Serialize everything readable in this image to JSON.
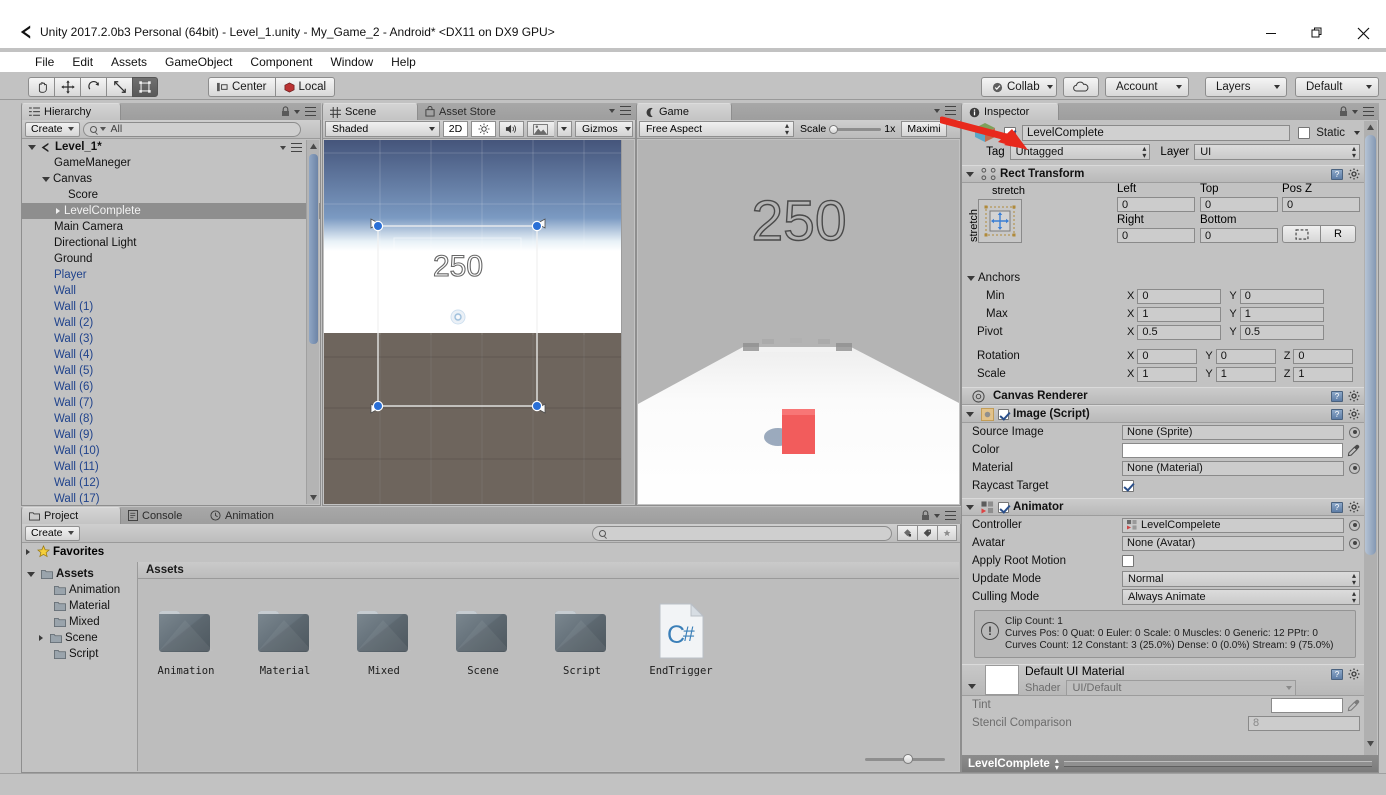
{
  "window": {
    "title": "Unity 2017.2.0b3 Personal (64bit) - Level_1.unity - My_Game_2 - Android* <DX11 on DX9 GPU>",
    "minimize": "–",
    "maximize": "❐",
    "close": "✕"
  },
  "menu": [
    "File",
    "Edit",
    "Assets",
    "GameObject",
    "Component",
    "Window",
    "Help"
  ],
  "toolbar": {
    "transform_tools": [
      "hand-tool",
      "move-tool",
      "rotate-tool",
      "scale-tool",
      "rect-tool"
    ],
    "pivot_mode": "Center",
    "pivot_rotation": "Local",
    "play": "▶",
    "pause": "❚❚",
    "step": "▶❘",
    "collab": "Collab",
    "cloud": "cloud-icon",
    "account": "Account",
    "layers": "Layers",
    "layout": "Default"
  },
  "hierarchy": {
    "tab": "Hierarchy",
    "create": "Create",
    "search_placeholder": "All",
    "scene_name": "Level_1*",
    "items": [
      {
        "label": "GameManeger",
        "indent": 1,
        "arrow": "none",
        "style": "normal"
      },
      {
        "label": "Canvas",
        "indent": 1,
        "arrow": "open",
        "style": "normal"
      },
      {
        "label": "Score",
        "indent": 2,
        "arrow": "none",
        "style": "normal"
      },
      {
        "label": "LevelComplete",
        "indent": 2,
        "arrow": "closed",
        "style": "selected"
      },
      {
        "label": "Main Camera",
        "indent": 1,
        "arrow": "none",
        "style": "normal"
      },
      {
        "label": "Directional Light",
        "indent": 1,
        "arrow": "none",
        "style": "normal"
      },
      {
        "label": "Ground",
        "indent": 1,
        "arrow": "none",
        "style": "normal"
      },
      {
        "label": "Player",
        "indent": 1,
        "arrow": "none",
        "style": "prefab"
      },
      {
        "label": "Wall",
        "indent": 1,
        "arrow": "none",
        "style": "prefab"
      },
      {
        "label": "Wall (1)",
        "indent": 1,
        "arrow": "none",
        "style": "prefab"
      },
      {
        "label": "Wall (2)",
        "indent": 1,
        "arrow": "none",
        "style": "prefab"
      },
      {
        "label": "Wall (3)",
        "indent": 1,
        "arrow": "none",
        "style": "prefab"
      },
      {
        "label": "Wall (4)",
        "indent": 1,
        "arrow": "none",
        "style": "prefab"
      },
      {
        "label": "Wall (5)",
        "indent": 1,
        "arrow": "none",
        "style": "prefab"
      },
      {
        "label": "Wall (6)",
        "indent": 1,
        "arrow": "none",
        "style": "prefab"
      },
      {
        "label": "Wall (7)",
        "indent": 1,
        "arrow": "none",
        "style": "prefab"
      },
      {
        "label": "Wall (8)",
        "indent": 1,
        "arrow": "none",
        "style": "prefab"
      },
      {
        "label": "Wall (9)",
        "indent": 1,
        "arrow": "none",
        "style": "prefab"
      },
      {
        "label": "Wall (10)",
        "indent": 1,
        "arrow": "none",
        "style": "prefab"
      },
      {
        "label": "Wall (11)",
        "indent": 1,
        "arrow": "none",
        "style": "prefab"
      },
      {
        "label": "Wall (12)",
        "indent": 1,
        "arrow": "none",
        "style": "prefab"
      },
      {
        "label": "Wall (17)",
        "indent": 1,
        "arrow": "none",
        "style": "prefab"
      }
    ]
  },
  "scene": {
    "tab": "Scene",
    "tab2": "Asset Store",
    "shading": "Shaded",
    "mode2d": "2D",
    "lighting": "lighting-icon",
    "audio": "audio-icon",
    "effects": "effects-icon",
    "gizmos": "Gizmos",
    "score_text": "250"
  },
  "game": {
    "tab": "Game",
    "aspect": "Free Aspect",
    "scale_label": "Scale",
    "scale_value": "1x",
    "maximize": "Maximi",
    "score_text": "250"
  },
  "project": {
    "tab": "Project",
    "tab_console": "Console",
    "tab_animation": "Animation",
    "create": "Create",
    "favorites": "Favorites",
    "breadcrumb": "Assets",
    "tree": [
      {
        "label": "Assets",
        "indent": 0,
        "arrow": "open",
        "bold": true
      },
      {
        "label": "Animation",
        "indent": 1,
        "arrow": "none",
        "bold": false
      },
      {
        "label": "Material",
        "indent": 1,
        "arrow": "none",
        "bold": false
      },
      {
        "label": "Mixed",
        "indent": 1,
        "arrow": "none",
        "bold": false
      },
      {
        "label": "Scene",
        "indent": 1,
        "arrow": "closed",
        "bold": false
      },
      {
        "label": "Script",
        "indent": 1,
        "arrow": "none",
        "bold": false
      }
    ],
    "assets": [
      {
        "label": "Animation",
        "type": "folder"
      },
      {
        "label": "Material",
        "type": "folder"
      },
      {
        "label": "Mixed",
        "type": "folder"
      },
      {
        "label": "Scene",
        "type": "folder"
      },
      {
        "label": "Script",
        "type": "folder"
      },
      {
        "label": "EndTrigger",
        "type": "csharp"
      }
    ]
  },
  "inspector": {
    "tab": "Inspector",
    "object_name": "LevelComplete",
    "object_enabled": true,
    "static_label": "Static",
    "tag_label": "Tag",
    "tag_value": "Untagged",
    "layer_label": "Layer",
    "layer_value": "UI",
    "rect_transform": {
      "title": "Rect Transform",
      "anchor_preset": "stretch",
      "anchor_preset_side": "stretch",
      "labels": {
        "left": "Left",
        "top": "Top",
        "posz": "Pos Z",
        "right": "Right",
        "bottom": "Bottom"
      },
      "left": "0",
      "top": "0",
      "posz": "0",
      "right": "0",
      "bottom": "0",
      "blueprint_btn": "blueprint-icon",
      "rawedit_btn": "R",
      "anchors_label": "Anchors",
      "min_label": "Min",
      "min_x": "0",
      "min_y": "0",
      "max_label": "Max",
      "max_x": "1",
      "max_y": "1",
      "pivot_label": "Pivot",
      "pivot_x": "0.5",
      "pivot_y": "0.5",
      "rotation_label": "Rotation",
      "rot_x": "0",
      "rot_y": "0",
      "rot_z": "0",
      "scale_label": "Scale",
      "scale_x": "1",
      "scale_y": "1",
      "scale_z": "1"
    },
    "canvas_renderer": {
      "title": "Canvas Renderer"
    },
    "image": {
      "title": "Image (Script)",
      "enabled": true,
      "source_image_label": "Source Image",
      "source_image_value": "None (Sprite)",
      "color_label": "Color",
      "color_value": "#FFFFFF",
      "material_label": "Material",
      "material_value": "None (Material)",
      "raycast_label": "Raycast Target",
      "raycast_checked": true
    },
    "animator": {
      "title": "Animator",
      "enabled": true,
      "controller_label": "Controller",
      "controller_value": "LevelCompelete",
      "avatar_label": "Avatar",
      "avatar_value": "None (Avatar)",
      "root_motion_label": "Apply Root Motion",
      "root_motion_checked": false,
      "update_mode_label": "Update Mode",
      "update_mode_value": "Normal",
      "culling_mode_label": "Culling Mode",
      "culling_mode_value": "Always Animate",
      "info_line1": "Clip Count: 1",
      "info_line2": "Curves Pos: 0 Quat: 0 Euler: 0 Scale: 0 Muscles: 0 Generic: 12 PPtr: 0",
      "info_line3": "Curves Count: 12 Constant: 3 (25.0%) Dense: 0 (0.0%) Stream: 9 (75.0%)"
    },
    "material": {
      "title": "Default UI Material",
      "shader_label": "Shader",
      "shader_value": "UI/Default",
      "tint_label": "Tint",
      "tint_value": "#FFFFFF",
      "stencil_label": "Stencil Comparison",
      "stencil_value": "8"
    },
    "footer_name": "LevelComplete"
  },
  "colors": {
    "chrome": "#c2c2c2",
    "prefab_blue": "#20438c",
    "selection": "#8e8e8e",
    "player_red": "#f25c5c",
    "annotation_red": "#e8291c"
  }
}
